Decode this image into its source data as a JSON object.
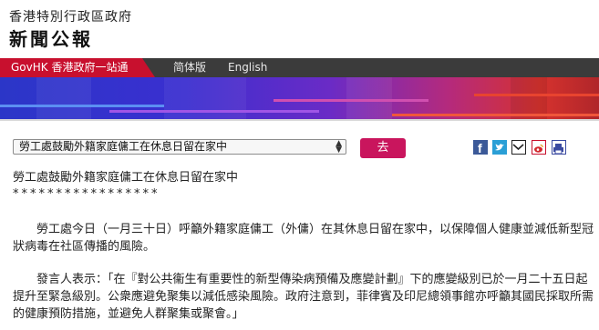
{
  "header": {
    "gov_name": "香港特別行政區政府",
    "site_title": "新聞公報"
  },
  "nav": {
    "govhk": "GovHK 香港政府一站通",
    "simplified": "简体版",
    "english": "English"
  },
  "toolbar": {
    "selected_article": "勞工處鼓勵外籍家庭傭工在休息日留在家中",
    "go_label": "去",
    "share_icons": [
      "facebook-icon",
      "twitter-icon",
      "email-icon",
      "weibo-icon",
      "print-icon"
    ]
  },
  "article": {
    "title": "勞工處鼓勵外籍家庭傭工在休息日留在家中",
    "stars": "*****************",
    "paragraphs": [
      "勞工處今日（一月三十日）呼籲外籍家庭傭工（外傭）在其休息日留在家中，以保障個人健康並減低新型冠狀病毒在社區傳播的風險。",
      "發言人表示：「在『對公共衞生有重要性的新型傳染病預備及應變計劃』下的應變級別已於一月二十五日起提升至緊急級別。公衆應避免聚集以減低感染風險。政府注意到，菲律賓及印尼總領事館亦呼籲其國民採取所需的健康預防措施，並避免人群聚集或聚會。」"
    ]
  },
  "colors": {
    "govhk_red": "#c8102e",
    "nav_bg": "#3b3b3b",
    "go_button": "#c9155d"
  }
}
